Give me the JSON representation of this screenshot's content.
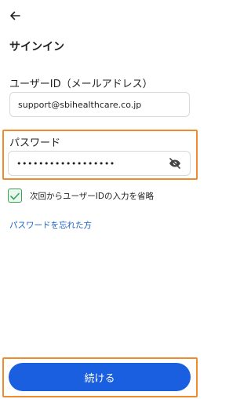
{
  "header": {
    "back_icon": "arrow-left-icon",
    "title": "サインイン"
  },
  "userid": {
    "label": "ユーザーID（メールアドレス）",
    "value": "support@sbihealthcare.co.jp"
  },
  "password": {
    "label": "パスワード",
    "masked_value": "••••••••••••••••••",
    "visibility_icon": "eye-off-icon"
  },
  "remember": {
    "checked": true,
    "label": "次回からユーザーIDの入力を省略"
  },
  "forgot_link": "パスワードを忘れた方",
  "continue_button": "続ける",
  "colors": {
    "primary": "#1a5fe0",
    "link": "#1d5fc4",
    "check": "#3aa357",
    "highlight": "#ef8a2f"
  }
}
